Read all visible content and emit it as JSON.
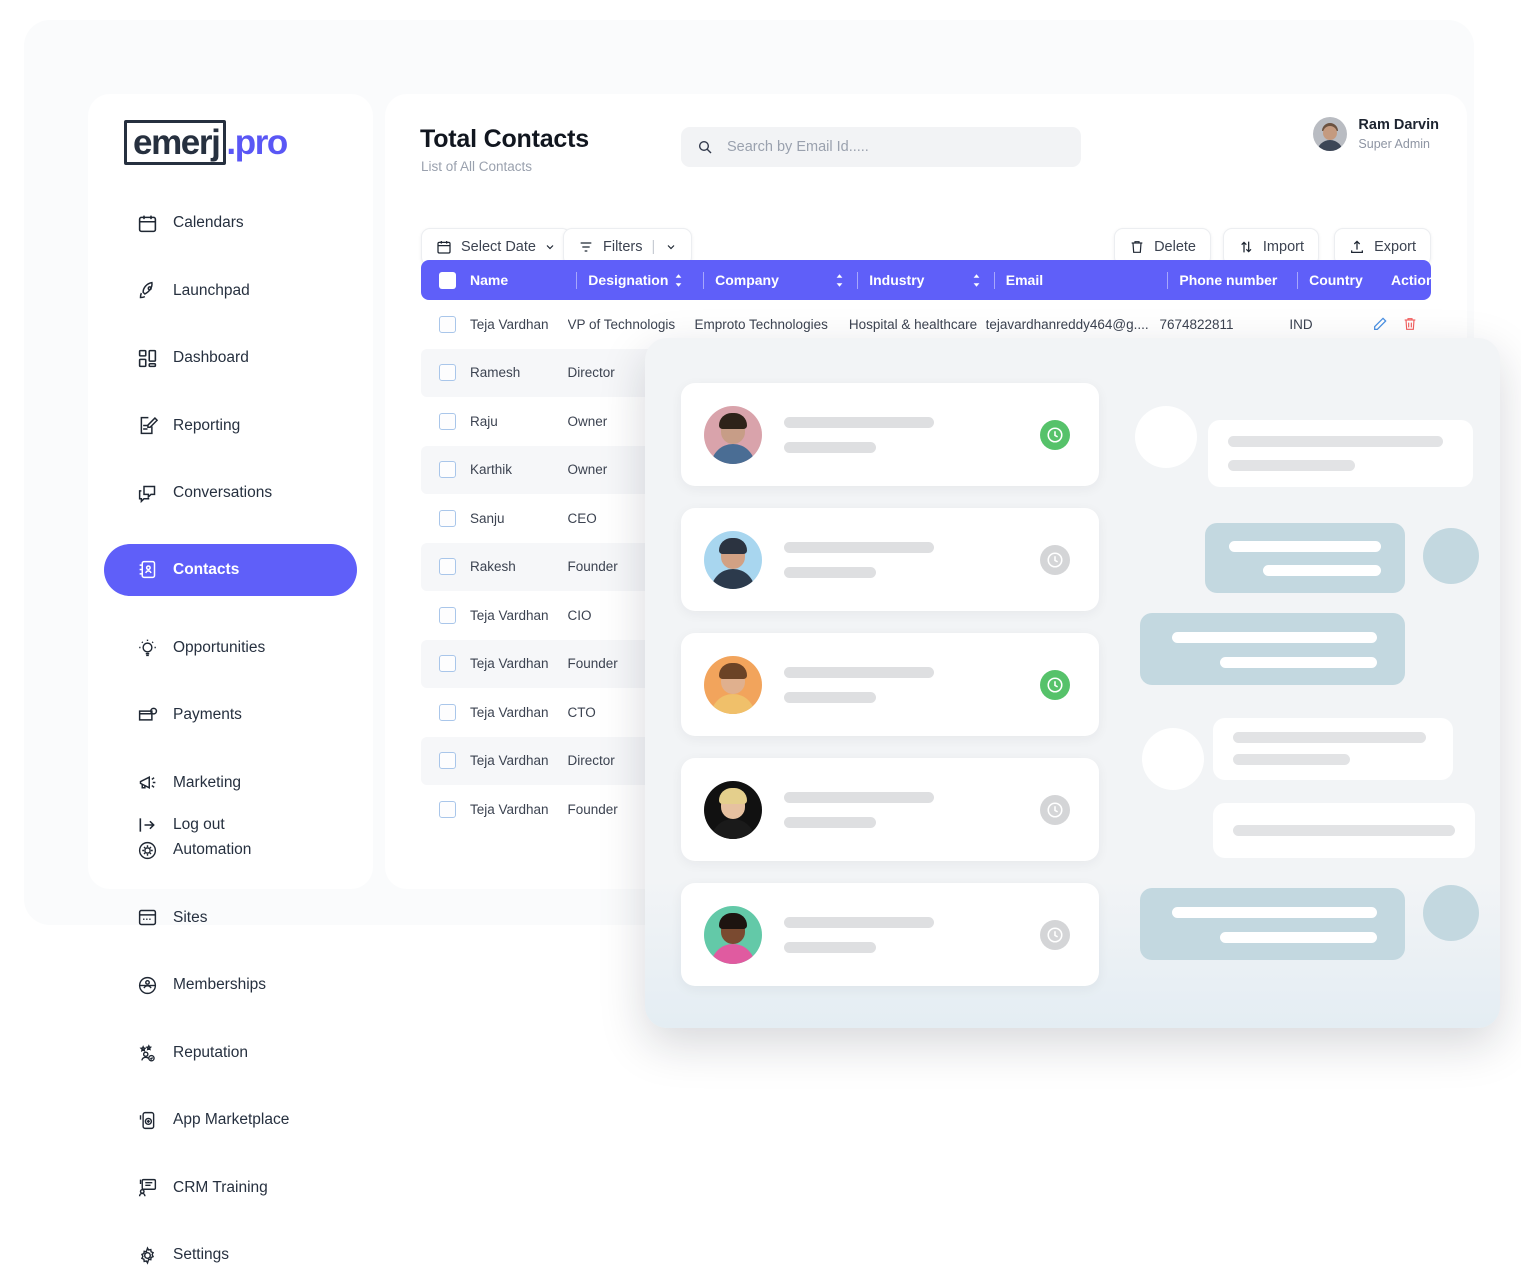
{
  "brand": {
    "name": "emerj",
    "suffix": ".pro",
    "accent": "#5a57f5"
  },
  "sidebar": {
    "items": [
      {
        "label": "Calendars",
        "icon": "calendar-icon",
        "active": false
      },
      {
        "label": "Launchpad",
        "icon": "rocket-icon",
        "active": false
      },
      {
        "label": "Dashboard",
        "icon": "dashboard-grid-icon",
        "active": false
      },
      {
        "label": "Reporting",
        "icon": "report-pencil-icon",
        "active": false
      },
      {
        "label": "Conversations",
        "icon": "chat-bubbles-icon",
        "active": false
      },
      {
        "label": "Contacts",
        "icon": "contact-book-icon",
        "active": true
      },
      {
        "label": "Opportunities",
        "icon": "lightbulb-icon",
        "active": false
      },
      {
        "label": "Payments",
        "icon": "card-check-icon",
        "active": false
      },
      {
        "label": "Marketing",
        "icon": "megaphone-icon",
        "active": false
      },
      {
        "label": "Automation",
        "icon": "gear-circle-icon",
        "active": false
      },
      {
        "label": "Sites",
        "icon": "browser-window-icon",
        "active": false
      },
      {
        "label": "Memberships",
        "icon": "members-globe-icon",
        "active": false
      },
      {
        "label": "Reputation",
        "icon": "star-user-icon",
        "active": false
      },
      {
        "label": "App Marketplace",
        "icon": "mobile-app-icon",
        "active": false
      },
      {
        "label": "CRM Training",
        "icon": "training-board-icon",
        "active": false
      },
      {
        "label": "Settings",
        "icon": "gear-icon",
        "active": false
      }
    ],
    "logout": {
      "label": "Log out",
      "icon": "logout-arrow-icon"
    }
  },
  "header": {
    "title": "Total Contacts",
    "subtitle": "List of All Contacts",
    "search": {
      "placeholder": "Search by Email Id.....",
      "value": "",
      "icon": "search-icon"
    },
    "profile": {
      "name": "Ram Darvin",
      "role": "Super Admin",
      "avatar": "avatar"
    }
  },
  "toolbar": {
    "select_date": {
      "label": "Select Date",
      "icon": "calendar-icon",
      "caret": "chevron-down-icon"
    },
    "filters": {
      "label": "Filters",
      "icon": "filter-funnel-icon",
      "caret": "chevron-down-icon"
    },
    "delete": {
      "label": "Delete",
      "icon": "trash-icon"
    },
    "import": {
      "label": "Import",
      "icon": "import-arrows-icon"
    },
    "export": {
      "label": "Export",
      "icon": "export-upload-icon"
    }
  },
  "table": {
    "header_bg": "#5f5ff9",
    "columns": [
      {
        "label": "Name",
        "sortable": false
      },
      {
        "label": "Designation",
        "sortable": true
      },
      {
        "label": "Company",
        "sortable": true
      },
      {
        "label": "Industry",
        "sortable": true
      },
      {
        "label": "Email",
        "sortable": false
      },
      {
        "label": "Phone number",
        "sortable": false
      },
      {
        "label": "Country",
        "sortable": false
      },
      {
        "label": "Action",
        "sortable": false
      }
    ],
    "rows": [
      {
        "name": "Teja Vardhan",
        "designation": "VP of Technologis",
        "company": "Emproto Technologies",
        "industry": "Hospital & healthcare",
        "email": "tejavardhanreddy464@g....",
        "phone": "7674822811",
        "country": "IND"
      },
      {
        "name": "Ramesh",
        "designation": "Director",
        "company": "",
        "industry": "",
        "email": "",
        "phone": "",
        "country": ""
      },
      {
        "name": "Raju",
        "designation": "Owner",
        "company": "",
        "industry": "",
        "email": "",
        "phone": "",
        "country": ""
      },
      {
        "name": "Karthik",
        "designation": "Owner",
        "company": "",
        "industry": "",
        "email": "",
        "phone": "",
        "country": ""
      },
      {
        "name": "Sanju",
        "designation": "CEO",
        "company": "",
        "industry": "",
        "email": "",
        "phone": "",
        "country": ""
      },
      {
        "name": "Rakesh",
        "designation": "Founder",
        "company": "",
        "industry": "",
        "email": "",
        "phone": "",
        "country": ""
      },
      {
        "name": "Teja Vardhan",
        "designation": "CIO",
        "company": "",
        "industry": "",
        "email": "",
        "phone": "",
        "country": ""
      },
      {
        "name": "Teja Vardhan",
        "designation": "Founder",
        "company": "",
        "industry": "",
        "email": "",
        "phone": "",
        "country": ""
      },
      {
        "name": "Teja Vardhan",
        "designation": "CTO",
        "company": "",
        "industry": "",
        "email": "",
        "phone": "",
        "country": ""
      },
      {
        "name": "Teja Vardhan",
        "designation": "Director",
        "company": "",
        "industry": "",
        "email": "",
        "phone": "",
        "country": ""
      },
      {
        "name": "Teja Vardhan",
        "designation": "Founder",
        "company": "",
        "industry": "",
        "email": "",
        "phone": "",
        "country": ""
      }
    ],
    "row_actions": {
      "edit_icon": "pencil-edit-icon",
      "edit_color": "#4a90e2",
      "delete_icon": "trash-icon",
      "delete_color": "#f25c5c"
    }
  },
  "overlay": {
    "cards": [
      {
        "status": "active",
        "badge_icon": "clock-icon",
        "badge_color": "#56c26a",
        "skin": "#c79d87",
        "hair": "#2e2219",
        "shirt": "#4a6d94",
        "ring": "#d9a3ab"
      },
      {
        "status": "inactive",
        "badge_icon": "clock-icon",
        "badge_color": "#d4d5d7",
        "skin": "#d2a184",
        "hair": "#2b3340",
        "shirt": "#2c3a4c",
        "ring": "#a8d6ef"
      },
      {
        "status": "active",
        "badge_icon": "clock-icon",
        "badge_color": "#56c26a",
        "skin": "#e0b08e",
        "hair": "#6b4326",
        "shirt": "#f0c06a",
        "ring": "#f2a45c"
      },
      {
        "status": "inactive",
        "badge_icon": "clock-icon",
        "badge_color": "#d4d5d7",
        "skin": "#e6c1a0",
        "hair": "#e4cf8c",
        "shirt": "#1a1a1a",
        "ring": "#111111"
      },
      {
        "status": "inactive",
        "badge_icon": "clock-icon",
        "badge_color": "#d4d5d7",
        "skin": "#7a4a30",
        "hair": "#1d1410",
        "shirt": "#e05ba0",
        "ring": "#63c9a8"
      }
    ]
  }
}
